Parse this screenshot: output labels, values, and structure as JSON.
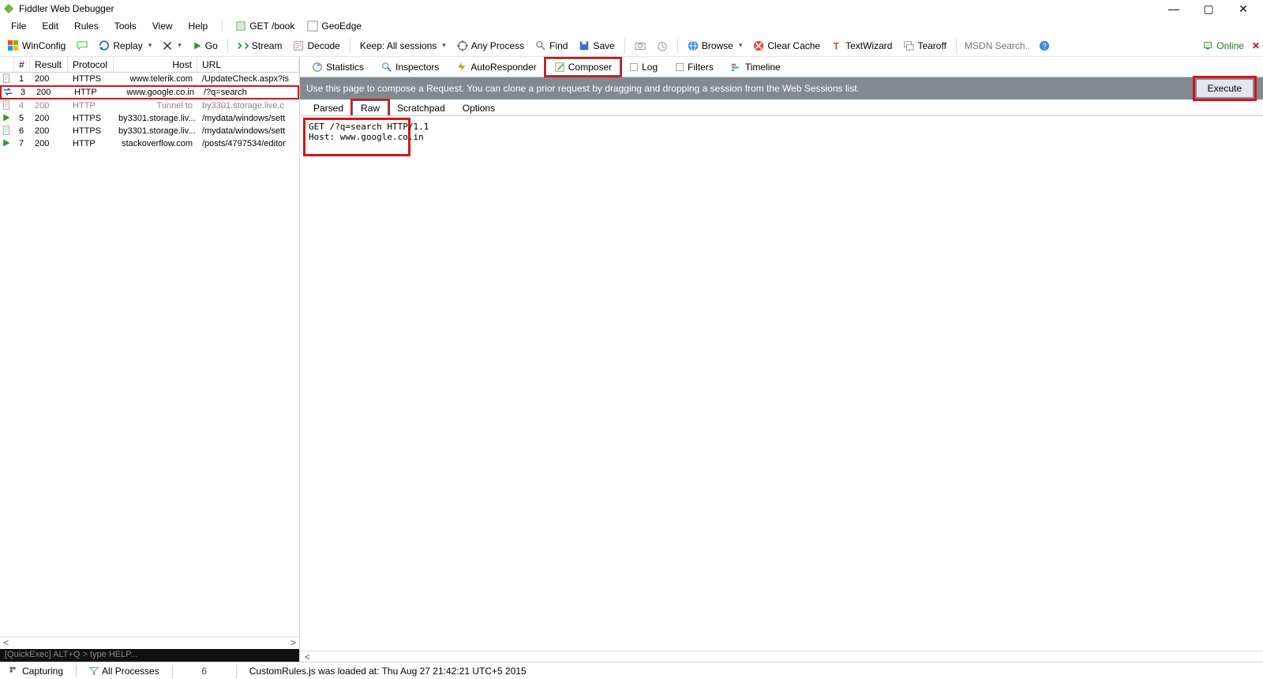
{
  "window": {
    "title": "Fiddler Web Debugger"
  },
  "menus": {
    "items": [
      "File",
      "Edit",
      "Rules",
      "Tools",
      "View",
      "Help"
    ],
    "get_book": "GET /book",
    "geoedge": "GeoEdge"
  },
  "toolbar": {
    "winconfig": "WinConfig",
    "replay": "Replay",
    "go": "Go",
    "stream": "Stream",
    "decode": "Decode",
    "keep": "Keep: All sessions",
    "anyprocess": "Any Process",
    "find": "Find",
    "save": "Save",
    "browse": "Browse",
    "clearcache": "Clear Cache",
    "textwizard": "TextWizard",
    "tearoff": "Tearoff",
    "search_placeholder": "MSDN Search...",
    "online": "Online"
  },
  "sessions": {
    "headers": {
      "id": "#",
      "result": "Result",
      "protocol": "Protocol",
      "host": "Host",
      "url": "URL"
    },
    "rows": [
      {
        "icon": "doc",
        "id": "1",
        "result": "200",
        "protocol": "HTTPS",
        "host": "www.telerik.com",
        "url": "/UpdateCheck.aspx?is",
        "hl": false,
        "dim_prev": true
      },
      {
        "icon": "arrows",
        "id": "3",
        "result": "200",
        "protocol": "HTTP",
        "host": "www.google.co.in",
        "url": "/?q=search",
        "hl": true
      },
      {
        "icon": "doc",
        "id": "4",
        "result": "200",
        "protocol": "HTTP",
        "host": "Tunnel to",
        "url": "by3301.storage.live.c",
        "dim": true
      },
      {
        "icon": "arrow",
        "id": "5",
        "result": "200",
        "protocol": "HTTPS",
        "host": "by3301.storage.liv...",
        "url": "/mydata/windows/sett"
      },
      {
        "icon": "doc",
        "id": "6",
        "result": "200",
        "protocol": "HTTPS",
        "host": "by3301.storage.liv...",
        "url": "/mydata/windows/sett"
      },
      {
        "icon": "arrow",
        "id": "7",
        "result": "200",
        "protocol": "HTTP",
        "host": "stackoverflow.com",
        "url": "/posts/4797534/editor"
      }
    ],
    "quickexec": "[QuickExec] ALT+Q > type HELP..."
  },
  "tabs1": {
    "statistics": "Statistics",
    "inspectors": "Inspectors",
    "autoresponder": "AutoResponder",
    "composer": "Composer",
    "log": "Log",
    "filters": "Filters",
    "timeline": "Timeline"
  },
  "infobar": {
    "text": "Use this page to compose a Request. You can clone a prior request by dragging and dropping a session from the Web Sessions list.",
    "execute": "Execute"
  },
  "tabs2": {
    "parsed": "Parsed",
    "raw": "Raw",
    "scratchpad": "Scratchpad",
    "options": "Options"
  },
  "raw": "GET /?q=search HTTP/1.1\nHost: www.google.co.in\n\n",
  "status": {
    "capturing": "Capturing",
    "all_processes": "All Processes",
    "count": "6",
    "rules": "CustomRules.js was loaded at: Thu Aug 27 21:42:21 UTC+5 2015"
  }
}
